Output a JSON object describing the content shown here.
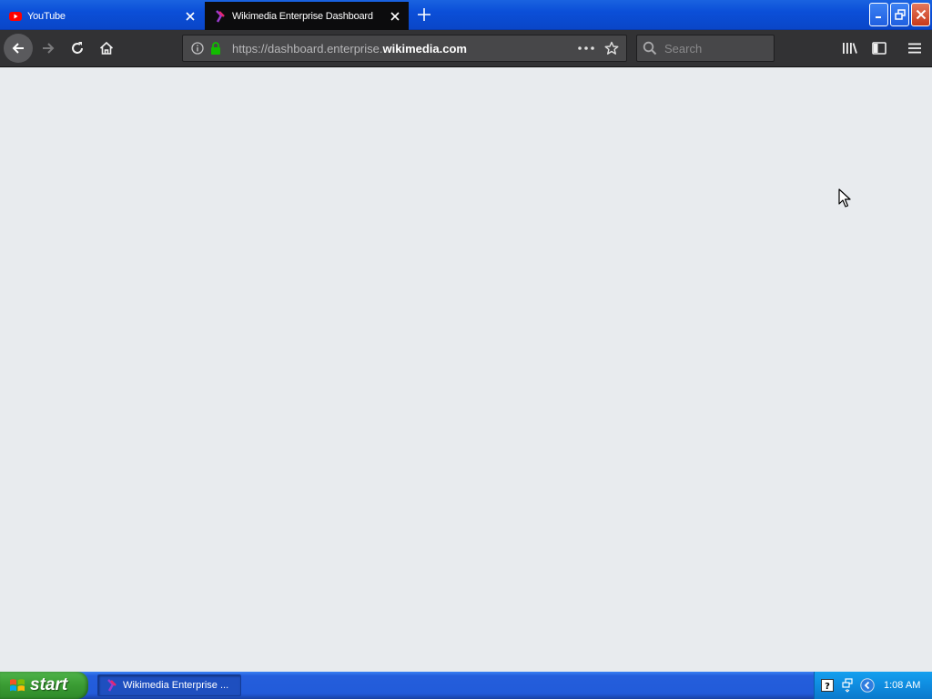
{
  "browser": {
    "tabs": [
      {
        "title": "YouTube",
        "active": false,
        "icon": "youtube-icon"
      },
      {
        "title": "Wikimedia Enterprise Dashboard",
        "active": true,
        "icon": "wikimedia-icon"
      }
    ],
    "url": {
      "prefix": "https://dashboard.enterprise.",
      "domain": "wikimedia.com"
    },
    "search": {
      "placeholder": "Search"
    }
  },
  "taskbar": {
    "start_label": "start",
    "window_item": "Wikimedia Enterprise ...",
    "clock": "1:08 AM"
  },
  "colors": {
    "titlebar_blue": "#0b4fd8",
    "active_tab": "#0c0c0d",
    "toolbar": "#323234",
    "content_bg": "#e8ebee",
    "lock_green": "#12bc00",
    "xp_start_green": "#3a9b33"
  }
}
